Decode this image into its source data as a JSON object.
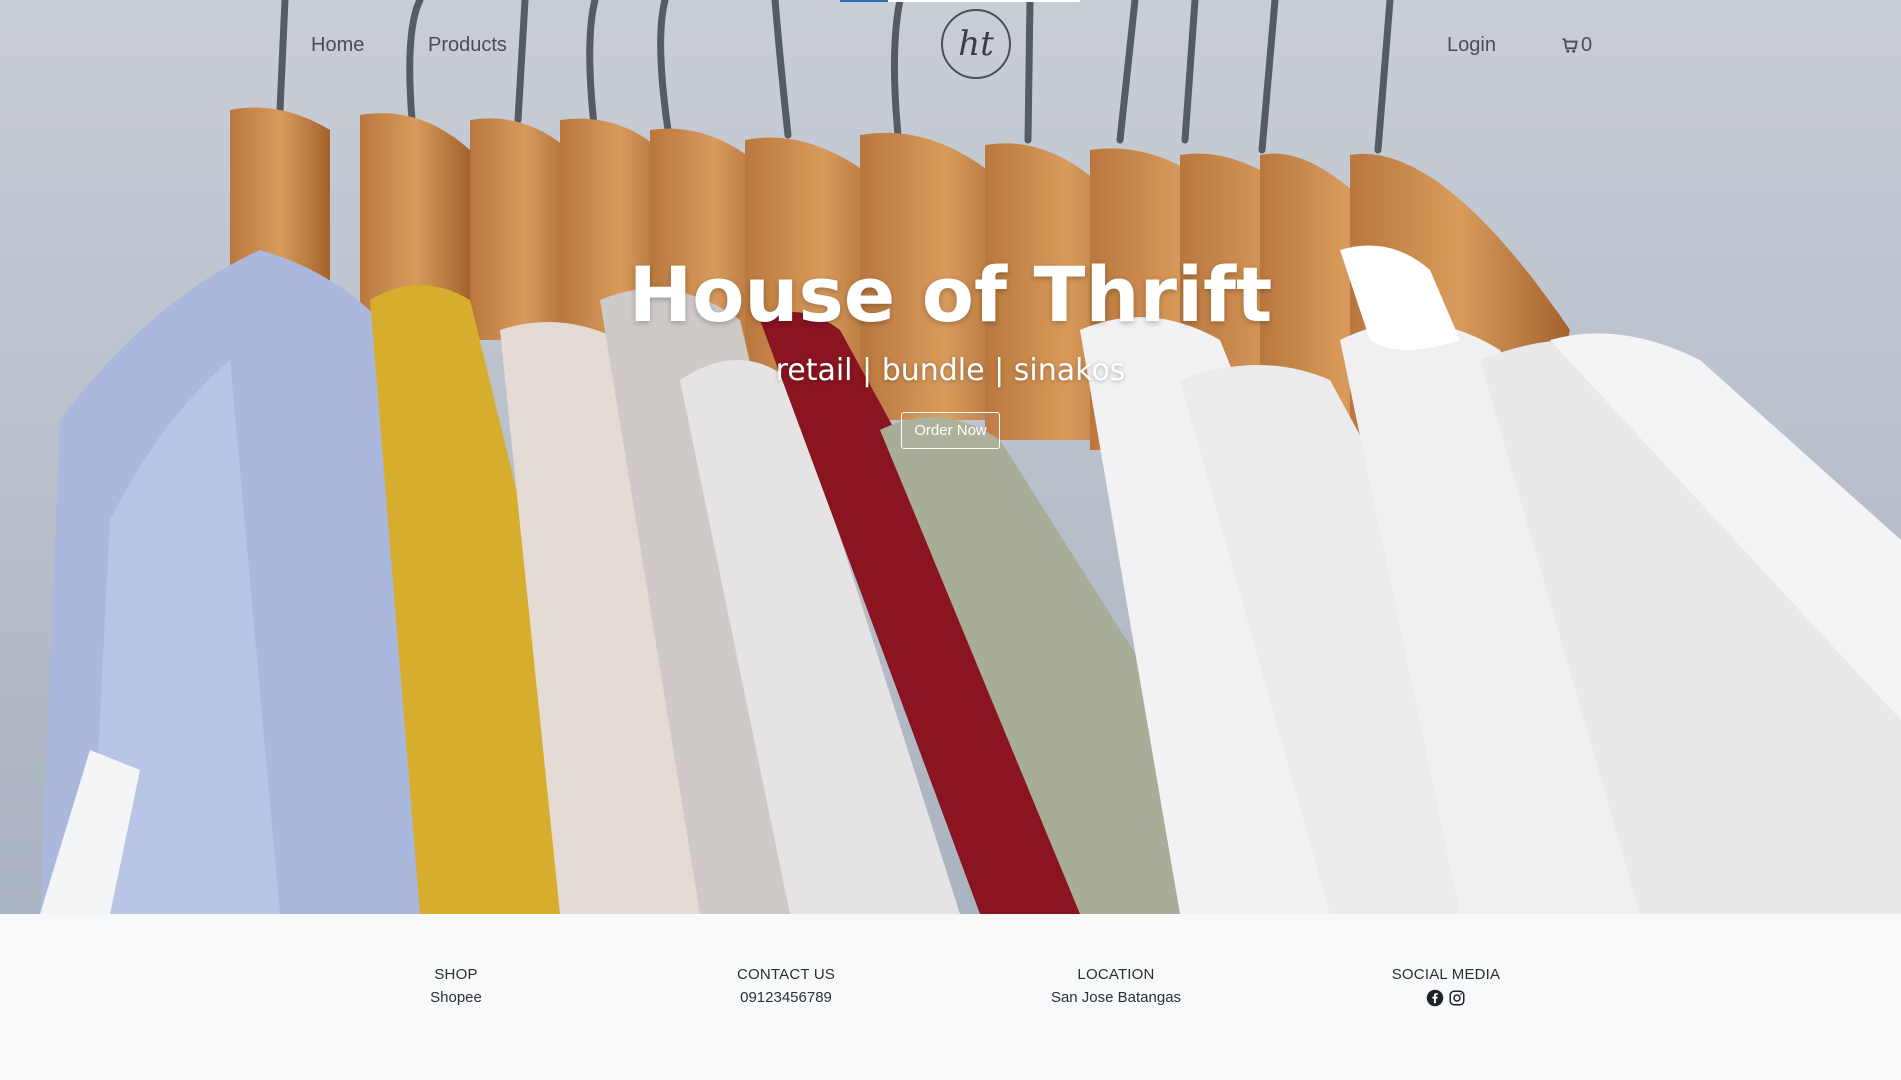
{
  "nav": {
    "home_label": "Home",
    "products_label": "Products",
    "logo_text": "ht",
    "login_label": "Login",
    "cart_count": "0"
  },
  "hero": {
    "title": "House of Thrift",
    "subtitle": "retail | bundle | sinakos",
    "button_label": "Order Now",
    "slide_progress": 0.2
  },
  "footer": {
    "shop_heading": "SHOP",
    "shop_value": "Shopee",
    "contact_heading": "CONTACT US",
    "contact_value": "09123456789",
    "location_heading": "LOCATION",
    "location_value": "San Jose Batangas",
    "social_heading": "SOCIAL MEDIA",
    "social_icons": [
      "facebook-icon",
      "instagram-icon"
    ]
  },
  "colors": {
    "text_dark": "#4a4f57",
    "footer_bg": "#f8f9fa",
    "hero_text": "#ffffff",
    "indicator_fill": "#2b6cb8"
  }
}
